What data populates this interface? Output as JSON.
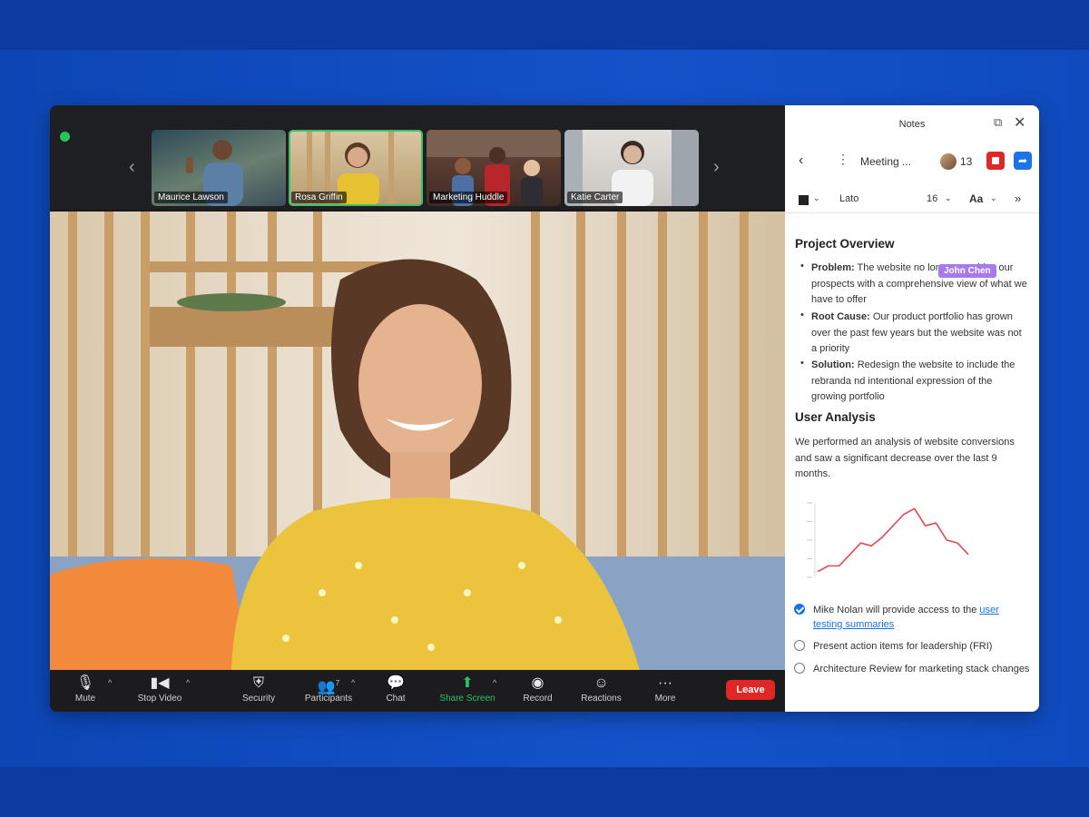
{
  "meeting": {
    "participants": [
      {
        "name": "Maurice Lawson",
        "active": false
      },
      {
        "name": "Rosa Griffin",
        "active": true
      },
      {
        "name": "Marketing Huddle",
        "active": false
      },
      {
        "name": "Katie Carter",
        "active": false
      }
    ],
    "toolbar": {
      "mute": "Mute",
      "stop_video": "Stop Video",
      "security": "Security",
      "participants": "Participants",
      "participants_count": "7",
      "chat": "Chat",
      "share_screen": "Share Screen",
      "record": "Record",
      "reactions": "Reactions",
      "more": "More",
      "leave": "Leave"
    },
    "accent": "#29c36a",
    "leave_color": "#e02626"
  },
  "notes": {
    "title": "Notes",
    "doc_title": "Meeting ...",
    "collaborators": "13",
    "font": "Lato",
    "size": "16",
    "aa": "Aa",
    "project_overview": {
      "heading": "Project Overview",
      "bullets": [
        {
          "label": "Problem:",
          "text": " The website no longer provides our prospects with a comprehensive view of what we have to offer"
        },
        {
          "label": "Root Cause:",
          "text": " Our product portfolio has grown over the past few years but the website was not a priority"
        },
        {
          "label": "Solution:",
          "text": " Redesign the website to include the rebranda nd intentional expression of the growing portfolio"
        }
      ]
    },
    "cursor_name": "John Chen",
    "user_analysis": {
      "heading": "User Analysis",
      "text": "We performed an analysis of website conversions and saw a significant decrease over the last 9 months."
    },
    "todos": [
      {
        "text": "Mike Nolan will provide access to the ",
        "link": "user testing summaries",
        "checked": true
      },
      {
        "text": "Present action items for leadership (FRI)",
        "link": "",
        "checked": false
      },
      {
        "text": "Architecture Review for marketing stack changes",
        "link": "",
        "checked": false
      }
    ],
    "accent": "#1a73e8"
  },
  "chart_data": {
    "type": "line",
    "x": [
      1,
      2,
      3,
      4,
      5,
      6,
      7,
      8,
      9,
      10,
      11,
      12,
      13,
      14,
      15
    ],
    "values": [
      1,
      2,
      2,
      4,
      6,
      5.5,
      7,
      9,
      11,
      12,
      9,
      9.5,
      6.5,
      6,
      4
    ],
    "title": "",
    "xlabel": "",
    "ylabel": "",
    "color": "#e5484d"
  }
}
